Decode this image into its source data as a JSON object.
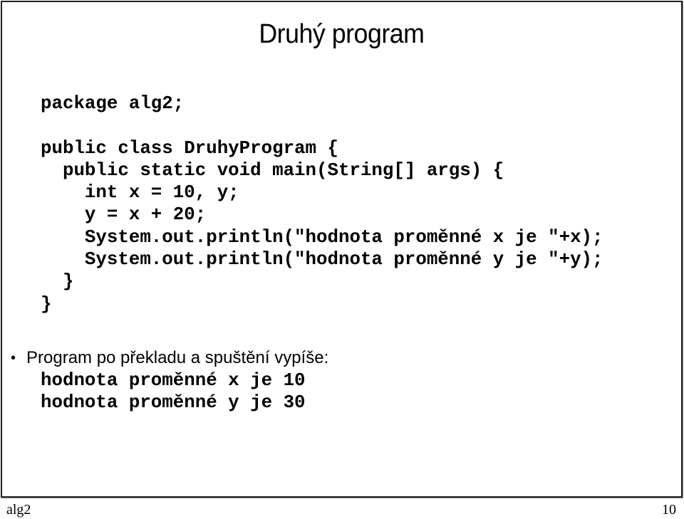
{
  "slide": {
    "title": "Druhý program",
    "code_lines": [
      "package alg2;",
      "",
      "public class DruhyProgram {",
      "  public static void main(String[] args) {",
      "    int x = 10, y;",
      "    y = x + 20;",
      "    System.out.println(\"hodnota proměnné x je \"+x);",
      "    System.out.println(\"hodnota proměnné y je \"+y);",
      "  }",
      "}"
    ],
    "bullet": {
      "icon": "bullet-dot",
      "symbol": "•",
      "text": "Program po překladu a spuštění vypíše:"
    },
    "output_lines": [
      "hodnota proměnné x je 10",
      "hodnota proměnné y je 30"
    ]
  },
  "footer": {
    "left": "alg2",
    "page_number": "10"
  }
}
